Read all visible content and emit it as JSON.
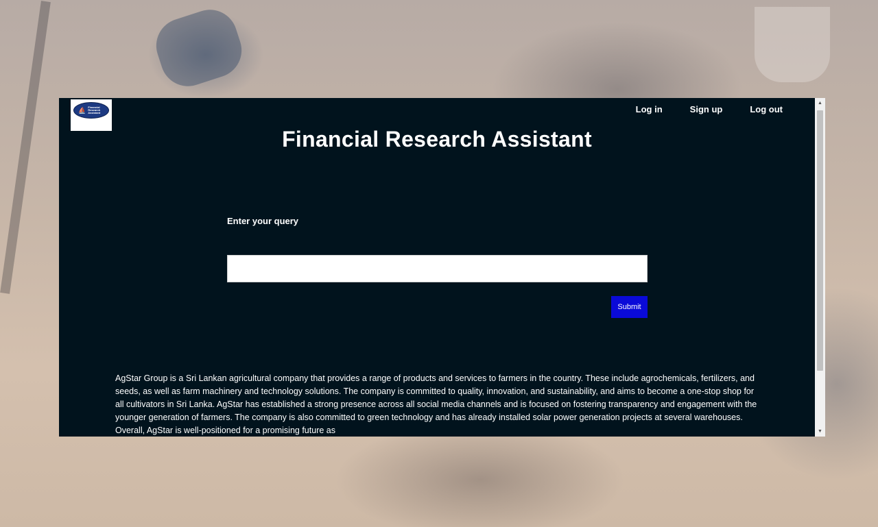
{
  "app": {
    "title": "Financial Research Assistant",
    "logo_text": "Financial Research Assistant"
  },
  "nav": {
    "login": "Log in",
    "signup": "Sign up",
    "logout": "Log out"
  },
  "form": {
    "label": "Enter your query",
    "input_value": "",
    "submit_label": "Submit"
  },
  "summary": "AgStar Group is a Sri Lankan agricultural company that provides a range of products and services to farmers in the country. These include agrochemicals, fertilizers, and seeds, as well as farm machinery and technology solutions. The company is committed to quality, innovation, and sustainability, and aims to become a one-stop shop for all cultivators in Sri Lanka. AgStar has established a strong presence across all social media channels and is focused on fostering transparency and engagement with the younger generation of farmers. The company is also committed to green technology and has already installed solar power generation projects at several warehouses. Overall, AgStar is well-positioned for a promising future as",
  "colors": {
    "window_bg": "#01131d",
    "submit_bg": "#0a0ad8",
    "logo_oval": "#1d3a82"
  }
}
